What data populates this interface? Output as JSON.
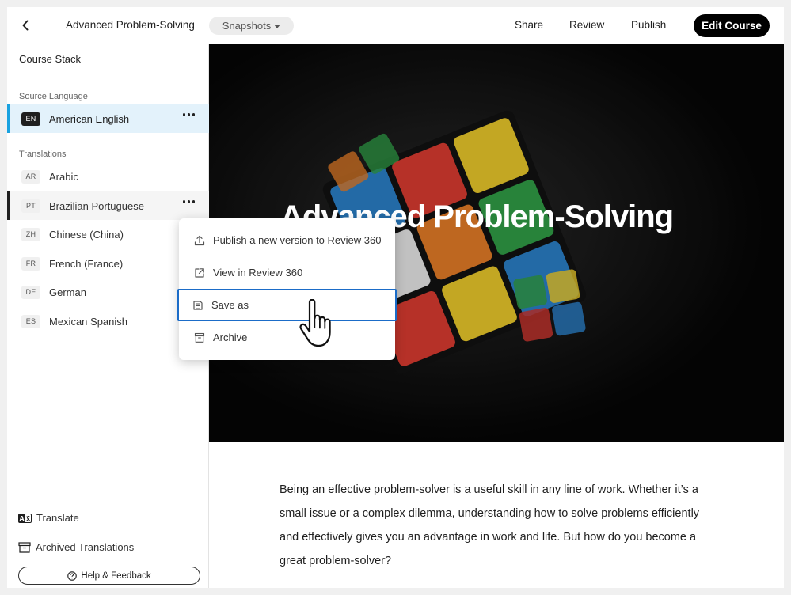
{
  "header": {
    "back_icon": "chevron-left-icon",
    "course_title": "Advanced Problem-Solving",
    "snapshots_label": "Snapshots",
    "share_label": "Share",
    "review_label": "Review",
    "publish_label": "Publish",
    "edit_course_label": "Edit Course"
  },
  "sidebar": {
    "title": "Course Stack",
    "source_section": "Source Language",
    "source": {
      "code": "EN",
      "name": "American English"
    },
    "translations_section": "Translations",
    "translations": [
      {
        "code": "AR",
        "name": "Arabic"
      },
      {
        "code": "PT",
        "name": "Brazilian Portuguese"
      },
      {
        "code": "ZH",
        "name": "Chinese (China)"
      },
      {
        "code": "FR",
        "name": "French (France)"
      },
      {
        "code": "DE",
        "name": "German"
      },
      {
        "code": "ES",
        "name": "Mexican Spanish"
      }
    ],
    "translate_label": "Translate",
    "archived_label": "Archived Translations",
    "help_label": "Help & Feedback"
  },
  "context_menu": {
    "items": [
      {
        "label": "Publish a new version to Review 360",
        "icon": "upload-icon"
      },
      {
        "label": "View in Review 360",
        "icon": "external-link-icon"
      },
      {
        "label": "Save as",
        "icon": "save-icon"
      },
      {
        "label": "Archive",
        "icon": "archive-icon"
      }
    ]
  },
  "hero": {
    "title": "Advanced Problem-Solving"
  },
  "content": {
    "paragraph": "Being an effective problem-solver is a useful skill in any line of work. Whether it’s a small issue or a complex dilemma, understanding how to solve problems efficiently and effectively gives you an advantage in work and life. But how do you become a great problem-solver?"
  },
  "colors": {
    "accent": "#1aa2e0",
    "active_row_bg": "#e3f2fb",
    "focus_ring": "#1b6cc8",
    "primary_button": "#000000"
  }
}
